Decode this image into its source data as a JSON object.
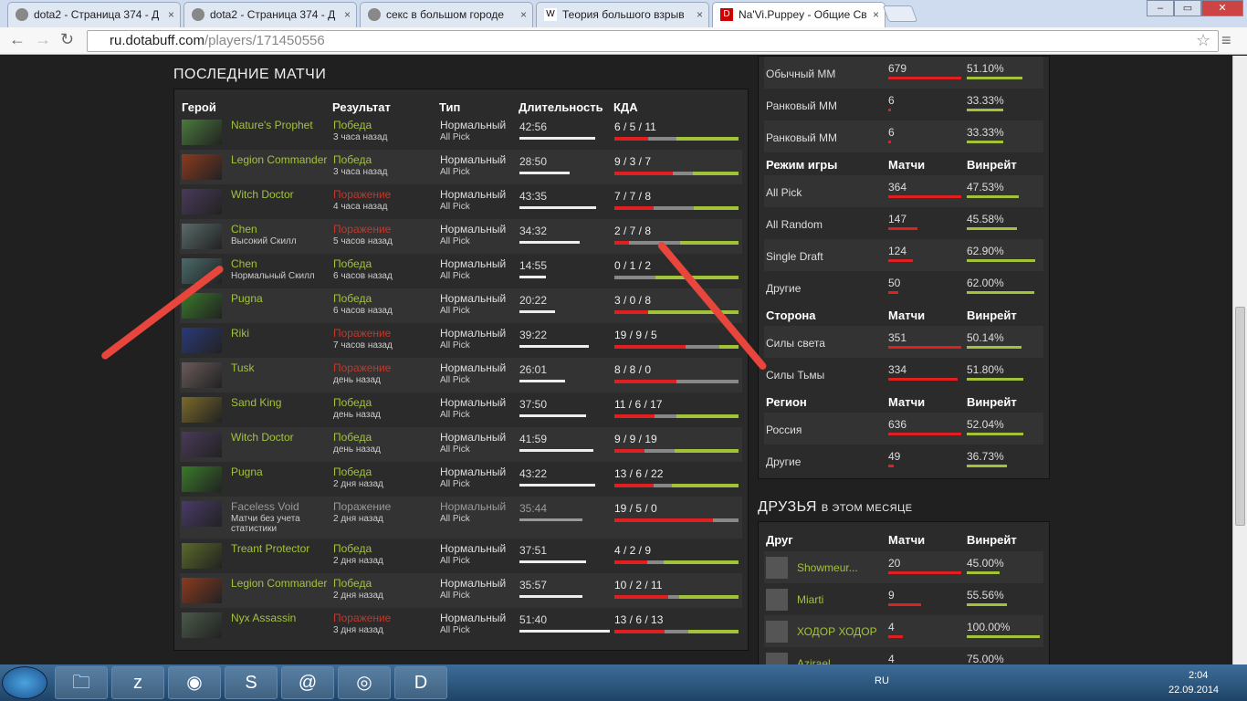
{
  "browser": {
    "tabs": [
      {
        "title": "dota2 - Страница 374 - Д",
        "favicon": "forum-icon"
      },
      {
        "title": "dota2 - Страница 374 - Д",
        "favicon": "forum-icon"
      },
      {
        "title": "секс в большом городе",
        "favicon": "search-icon"
      },
      {
        "title": "Теория большого взрыв",
        "favicon": "wikipedia-icon"
      },
      {
        "title": "Na'Vi.Puppey - Общие Св",
        "favicon": "dotabuff-icon"
      }
    ],
    "url_domain": "ru.dotabuff.com",
    "url_path": "/players/171450556"
  },
  "matches": {
    "title": "ПОСЛЕДНИЕ МАТЧИ",
    "headers": {
      "hero": "Герой",
      "result": "Результат",
      "type": "Тип",
      "duration": "Длительность",
      "kda": "КДА"
    },
    "rows": [
      {
        "hero": "Nature's Prophet",
        "sub": "",
        "result": "Победа",
        "res": "win",
        "when": "3 часа назад",
        "type": "Нормальный",
        "mode": "All Pick",
        "duration": "42:56",
        "dur_min": 42.9,
        "kda": "6 / 5 / 11",
        "k": 6,
        "d": 5,
        "a": 11
      },
      {
        "hero": "Legion Commander",
        "sub": "",
        "result": "Победа",
        "res": "win",
        "when": "3 часа назад",
        "type": "Нормальный",
        "mode": "All Pick",
        "duration": "28:50",
        "dur_min": 28.8,
        "kda": "9 / 3 / 7",
        "k": 9,
        "d": 3,
        "a": 7
      },
      {
        "hero": "Witch Doctor",
        "sub": "",
        "result": "Поражение",
        "res": "loss",
        "when": "4 часа назад",
        "type": "Нормальный",
        "mode": "All Pick",
        "duration": "43:35",
        "dur_min": 43.6,
        "kda": "7 / 7 / 8",
        "k": 7,
        "d": 7,
        "a": 8
      },
      {
        "hero": "Chen",
        "sub": "Высокий Скилл",
        "result": "Поражение",
        "res": "loss",
        "when": "5 часов назад",
        "type": "Нормальный",
        "mode": "All Pick",
        "duration": "34:32",
        "dur_min": 34.5,
        "kda": "2 / 7 / 8",
        "k": 2,
        "d": 7,
        "a": 8
      },
      {
        "hero": "Chen",
        "sub": "Нормальный Скилл",
        "result": "Победа",
        "res": "win",
        "when": "6 часов назад",
        "type": "Нормальный",
        "mode": "All Pick",
        "duration": "14:55",
        "dur_min": 14.9,
        "kda": "0 / 1 / 2",
        "k": 0,
        "d": 1,
        "a": 2
      },
      {
        "hero": "Pugna",
        "sub": "",
        "result": "Победа",
        "res": "win",
        "when": "6 часов назад",
        "type": "Нормальный",
        "mode": "All Pick",
        "duration": "20:22",
        "dur_min": 20.4,
        "kda": "3 / 0 / 8",
        "k": 3,
        "d": 0,
        "a": 8
      },
      {
        "hero": "Riki",
        "sub": "",
        "result": "Поражение",
        "res": "loss",
        "when": "7 часов назад",
        "type": "Нормальный",
        "mode": "All Pick",
        "duration": "39:22",
        "dur_min": 39.4,
        "kda": "19 / 9 / 5",
        "k": 19,
        "d": 9,
        "a": 5
      },
      {
        "hero": "Tusk",
        "sub": "",
        "result": "Поражение",
        "res": "loss",
        "when": "день назад",
        "type": "Нормальный",
        "mode": "All Pick",
        "duration": "26:01",
        "dur_min": 26.0,
        "kda": "8 / 8 / 0",
        "k": 8,
        "d": 8,
        "a": 0
      },
      {
        "hero": "Sand King",
        "sub": "",
        "result": "Победа",
        "res": "win",
        "when": "день назад",
        "type": "Нормальный",
        "mode": "All Pick",
        "duration": "37:50",
        "dur_min": 37.8,
        "kda": "11 / 6 / 17",
        "k": 11,
        "d": 6,
        "a": 17
      },
      {
        "hero": "Witch Doctor",
        "sub": "",
        "result": "Победа",
        "res": "win",
        "when": "день назад",
        "type": "Нормальный",
        "mode": "All Pick",
        "duration": "41:59",
        "dur_min": 42.0,
        "kda": "9 / 9 / 19",
        "k": 9,
        "d": 9,
        "a": 19
      },
      {
        "hero": "Pugna",
        "sub": "",
        "result": "Победа",
        "res": "win",
        "when": "2 дня назад",
        "type": "Нормальный",
        "mode": "All Pick",
        "duration": "43:22",
        "dur_min": 43.4,
        "kda": "13 / 6 / 22",
        "k": 13,
        "d": 6,
        "a": 22
      },
      {
        "hero": "Faceless Void",
        "sub": "Матчи без учета статистики",
        "result": "Поражение",
        "res": "dim",
        "when": "2 дня назад",
        "type": "Нормальный",
        "mode": "All Pick",
        "duration": "35:44",
        "dur_min": 35.7,
        "kda": "19 / 5 / 0",
        "k": 19,
        "d": 5,
        "a": 0
      },
      {
        "hero": "Treant Protector",
        "sub": "",
        "result": "Победа",
        "res": "win",
        "when": "2 дня назад",
        "type": "Нормальный",
        "mode": "All Pick",
        "duration": "37:51",
        "dur_min": 37.9,
        "kda": "4 / 2 / 9",
        "k": 4,
        "d": 2,
        "a": 9
      },
      {
        "hero": "Legion Commander",
        "sub": "",
        "result": "Победа",
        "res": "win",
        "when": "2 дня назад",
        "type": "Нормальный",
        "mode": "All Pick",
        "duration": "35:57",
        "dur_min": 36.0,
        "kda": "10 / 2 / 11",
        "k": 10,
        "d": 2,
        "a": 11
      },
      {
        "hero": "Nyx Assassin",
        "sub": "",
        "result": "Поражение",
        "res": "loss",
        "when": "3 дня назад",
        "type": "Нормальный",
        "mode": "All Pick",
        "duration": "51:40",
        "dur_min": 51.7,
        "kda": "13 / 6 / 13",
        "k": 13,
        "d": 6,
        "a": 13
      }
    ]
  },
  "stats": {
    "lobby_rows": [
      {
        "label": "Обычный ММ",
        "matches": "679",
        "winrate": "51.10%",
        "m": 679,
        "w": 51.1
      },
      {
        "label": "Ранковый ММ",
        "matches": "6",
        "winrate": "33.33%",
        "m": 6,
        "w": 33.33
      },
      {
        "label": "Ранковый ММ",
        "matches": "6",
        "winrate": "33.33%",
        "m": 6,
        "w": 33.33
      }
    ],
    "sections": [
      {
        "title": "Режим игры",
        "col1": "Матчи",
        "col2": "Винрейт",
        "rows": [
          {
            "label": "All Pick",
            "matches": "364",
            "winrate": "47.53%",
            "m": 364,
            "w": 47.53
          },
          {
            "label": "All Random",
            "matches": "147",
            "winrate": "45.58%",
            "m": 147,
            "w": 45.58
          },
          {
            "label": "Single Draft",
            "matches": "124",
            "winrate": "62.90%",
            "m": 124,
            "w": 62.9
          },
          {
            "label": "Другие",
            "matches": "50",
            "winrate": "62.00%",
            "m": 50,
            "w": 62.0
          }
        ]
      },
      {
        "title": "Сторона",
        "col1": "Матчи",
        "col2": "Винрейт",
        "rows": [
          {
            "label": "Силы света",
            "matches": "351",
            "winrate": "50.14%",
            "m": 351,
            "w": 50.14
          },
          {
            "label": "Силы Тьмы",
            "matches": "334",
            "winrate": "51.80%",
            "m": 334,
            "w": 51.8
          }
        ]
      },
      {
        "title": "Регион",
        "col1": "Матчи",
        "col2": "Винрейт",
        "rows": [
          {
            "label": "Россия",
            "matches": "636",
            "winrate": "52.04%",
            "m": 636,
            "w": 52.04
          },
          {
            "label": "Другие",
            "matches": "49",
            "winrate": "36.73%",
            "m": 49,
            "w": 36.73
          }
        ]
      }
    ]
  },
  "friends": {
    "title": "ДРУЗЬЯ",
    "subtitle": "В ЭТОМ МЕСЯЦЕ",
    "headers": {
      "friend": "Друг",
      "matches": "Матчи",
      "winrate": "Винрейт"
    },
    "rows": [
      {
        "name": "Showmeur...",
        "matches": "20",
        "winrate": "45.00%",
        "m": 20,
        "w": 45.0
      },
      {
        "name": "Miarti",
        "matches": "9",
        "winrate": "55.56%",
        "m": 9,
        "w": 55.56
      },
      {
        "name": "ХОДОР ХОДОР",
        "matches": "4",
        "winrate": "100.00%",
        "m": 4,
        "w": 100.0
      },
      {
        "name": "Azirael",
        "matches": "4",
        "winrate": "75.00%",
        "m": 4,
        "w": 75.0
      }
    ]
  },
  "taskbar": {
    "apps": [
      "explorer-icon",
      "z-app-icon",
      "steam-icon",
      "skype-icon",
      "mail-agent-icon",
      "chrome-icon",
      "dota2-icon"
    ],
    "lang": "RU",
    "time": "2:04",
    "date": "22.09.2014"
  },
  "colors": {
    "win": "#a2c23a",
    "loss": "#c0392b",
    "kill": "#e02020",
    "death": "#888888",
    "assist": "#a2c23a",
    "annotation": "#e8453c"
  }
}
